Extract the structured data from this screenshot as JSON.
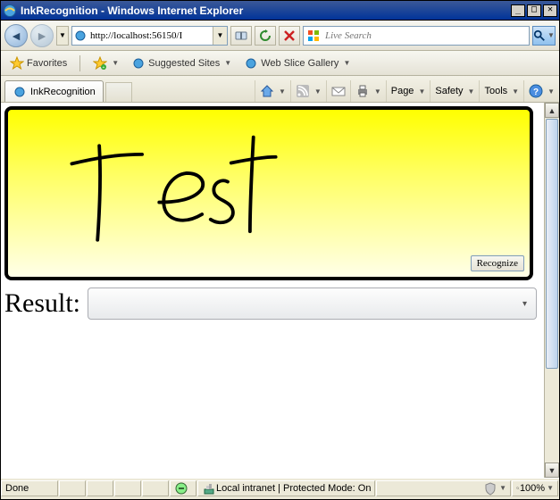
{
  "window": {
    "title": "InkRecognition - Windows Internet Explorer"
  },
  "nav": {
    "url": "http://localhost:56150/I",
    "search_placeholder": "Live Search"
  },
  "favbar": {
    "favorites_label": "Favorites",
    "suggested_label": "Suggested Sites",
    "webslice_label": "Web Slice Gallery"
  },
  "tab": {
    "title": "InkRecognition"
  },
  "commands": {
    "page": "Page",
    "safety": "Safety",
    "tools": "Tools"
  },
  "ink": {
    "recognize_label": "Recognize",
    "handwriting": "Test"
  },
  "result": {
    "label": "Result:",
    "value": ""
  },
  "status": {
    "done": "Done",
    "zone": "Local intranet | Protected Mode: On",
    "zoom": "100%"
  },
  "icons": {
    "ie": "ie-icon",
    "star": "star-icon",
    "refresh": "refresh-icon",
    "stop": "stop-icon",
    "search": "search-icon",
    "home": "home-icon",
    "feeds": "feeds-icon",
    "mail": "mail-icon",
    "print": "print-icon",
    "help": "help-icon"
  },
  "colors": {
    "accent": "#003399",
    "ink_bg_top": "#ffff00",
    "ink_bg_bottom": "#ffffe8"
  }
}
